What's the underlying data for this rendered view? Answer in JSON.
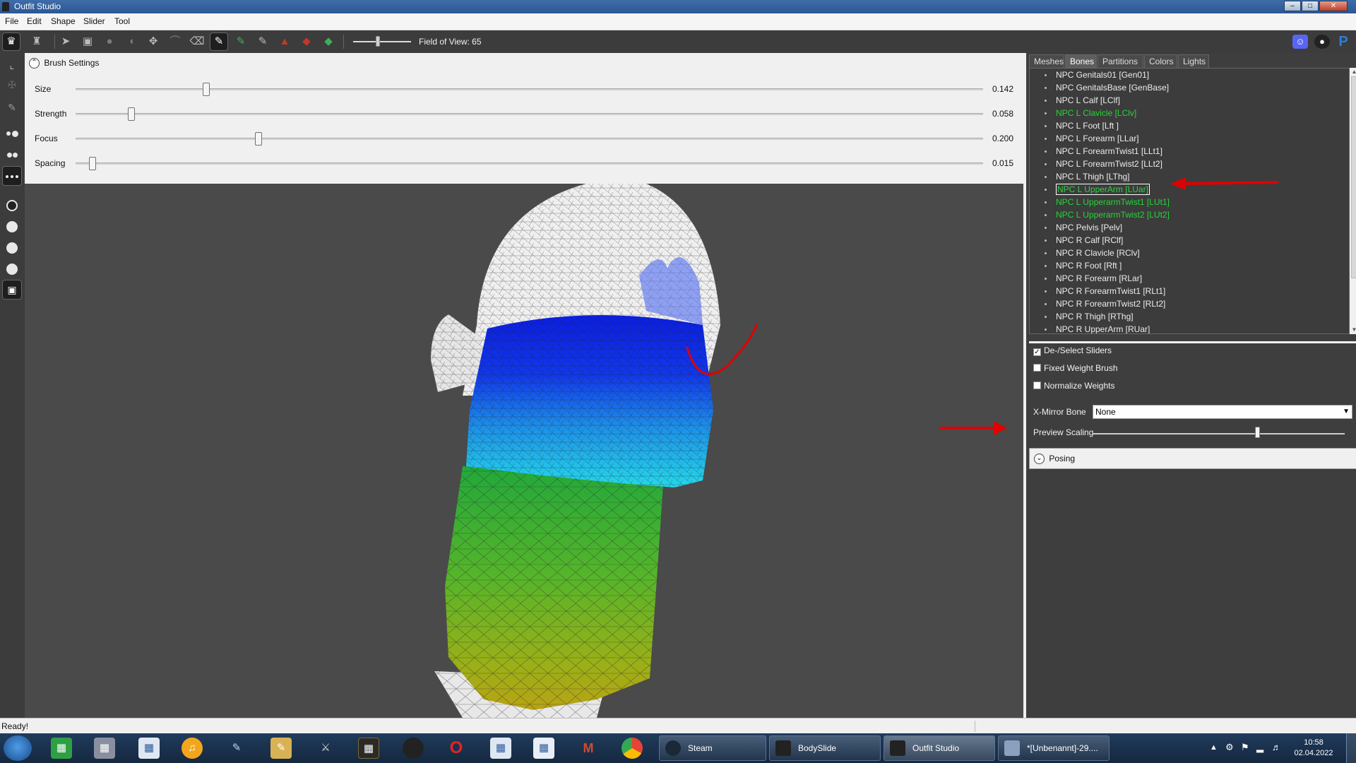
{
  "window": {
    "title": "Outfit Studio"
  },
  "menu": [
    "File",
    "Edit",
    "Shape",
    "Slider",
    "Tool"
  ],
  "toolbar": {
    "fov_label": "Field of View: 65"
  },
  "brush_settings": {
    "header": "Brush Settings",
    "rows": [
      {
        "label": "Size",
        "value": "0.142"
      },
      {
        "label": "Strength",
        "value": "0.058"
      },
      {
        "label": "Focus",
        "value": "0.200"
      },
      {
        "label": "Spacing",
        "value": "0.015"
      }
    ]
  },
  "tabs": [
    "Meshes",
    "Bones",
    "Partitions",
    "Colors",
    "Lights"
  ],
  "active_tab": "Bones",
  "bones": [
    {
      "name": "NPC Genitals01 [Gen01]",
      "state": "normal"
    },
    {
      "name": "NPC GenitalsBase [GenBase]",
      "state": "normal"
    },
    {
      "name": "NPC L Calf [LClf]",
      "state": "normal"
    },
    {
      "name": "NPC L Clavicle [LClv]",
      "state": "green"
    },
    {
      "name": "NPC L Foot [Lft ]",
      "state": "normal"
    },
    {
      "name": "NPC L Forearm [LLar]",
      "state": "normal"
    },
    {
      "name": "NPC L ForearmTwist1 [LLt1]",
      "state": "normal"
    },
    {
      "name": "NPC L ForearmTwist2 [LLt2]",
      "state": "normal"
    },
    {
      "name": "NPC L Thigh [LThg]",
      "state": "normal"
    },
    {
      "name": "NPC L UpperArm [LUar]",
      "state": "selected"
    },
    {
      "name": "NPC L UpperarmTwist1 [LUt1]",
      "state": "green"
    },
    {
      "name": "NPC L UpperarmTwist2 [LUt2]",
      "state": "green"
    },
    {
      "name": "NPC Pelvis [Pelv]",
      "state": "normal"
    },
    {
      "name": "NPC R Calf [RClf]",
      "state": "normal"
    },
    {
      "name": "NPC R Clavicle [RClv]",
      "state": "normal"
    },
    {
      "name": "NPC R Foot [Rft ]",
      "state": "normal"
    },
    {
      "name": "NPC R Forearm [RLar]",
      "state": "normal"
    },
    {
      "name": "NPC R ForearmTwist1 [RLt1]",
      "state": "normal"
    },
    {
      "name": "NPC R ForearmTwist2 [RLt2]",
      "state": "normal"
    },
    {
      "name": "NPC R Thigh [RThg]",
      "state": "normal"
    },
    {
      "name": "NPC R UpperArm [RUar]",
      "state": "normal"
    }
  ],
  "options": {
    "deselect_sliders": {
      "label": "De-/Select Sliders",
      "checked": true
    },
    "fixed_weight": {
      "label": "Fixed Weight Brush",
      "checked": false
    },
    "normalize_weights": {
      "label": "Normalize Weights",
      "checked": false
    },
    "xmirror_label": "X-Mirror Bone",
    "xmirror_value": "None",
    "preview_scaling_label": "Preview Scaling"
  },
  "posing": {
    "label": "Posing"
  },
  "status": {
    "text": "Ready!"
  },
  "taskbar": {
    "tasks": [
      {
        "label": "Steam",
        "active": false
      },
      {
        "label": "BodySlide",
        "active": false
      },
      {
        "label": "Outfit Studio",
        "active": true
      },
      {
        "label": "*[Unbenannt]-29....",
        "active": false
      }
    ],
    "clock_time": "10:58",
    "clock_date": "02.04.2022"
  },
  "colors": {
    "accent_green": "#24d636",
    "annotation_red": "#e00000",
    "toolbar_dark": "#3c3c3c",
    "viewport_bg": "#4a4a4a"
  }
}
